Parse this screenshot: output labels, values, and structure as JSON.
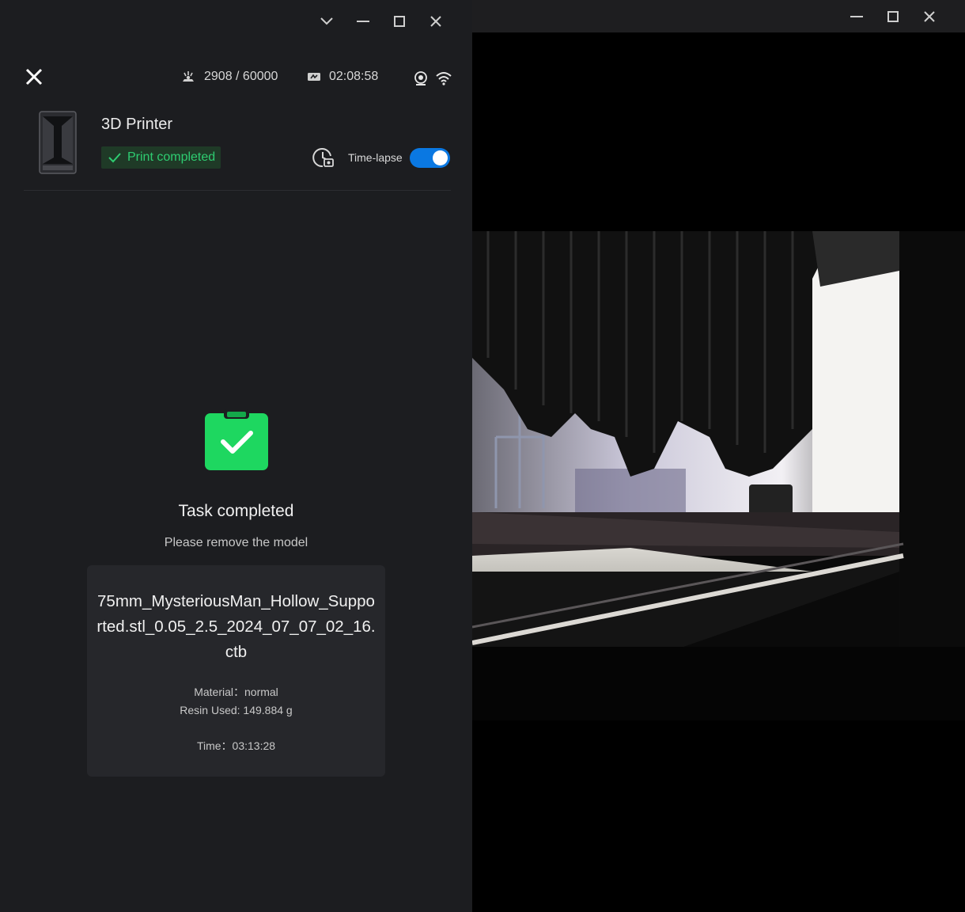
{
  "left_window": {
    "controls": [
      "chevron-down-icon",
      "minimize-icon",
      "maximize-icon",
      "close-icon"
    ]
  },
  "header": {
    "exposure_count": "2908 / 60000",
    "elapsed_time": "02:08:58"
  },
  "printer": {
    "name": "3D Printer",
    "status": "Print completed",
    "timelapse_label": "Time-lapse",
    "timelapse_enabled": true
  },
  "task": {
    "title": "Task completed",
    "subtitle": "Please remove the model",
    "file_name": "75mm_MysteriousMan_Hollow_Supported.stl_0.05_2.5_2024_07_07_02_16.ctb",
    "material": "Material：normal",
    "resin_used": "Resin Used: 149.884 g",
    "time": "Time：03:13:28"
  },
  "colors": {
    "panel_bg": "#1c1d20",
    "card_bg": "#26272b",
    "success_green": "#1ed760",
    "toggle_blue": "#0a78e2"
  }
}
